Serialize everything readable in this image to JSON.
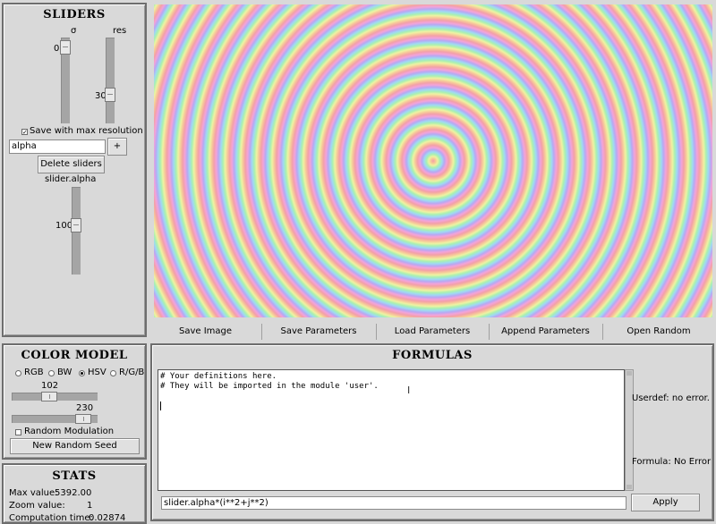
{
  "sliders_panel": {
    "title": "SLIDERS",
    "sigma_label": "σ",
    "sigma_value": "0",
    "res_label": "res",
    "res_value": "30",
    "save_max_res_label": "Save with max resolution",
    "save_max_res_checked": true,
    "new_slider_value": "alpha",
    "add_button": "+",
    "delete_button": "Delete sliders",
    "alpha_label": "slider.alpha",
    "alpha_value": "100"
  },
  "toolbar": {
    "save_image": "Save Image",
    "save_params": "Save Parameters",
    "load_params": "Load Parameters",
    "append_params": "Append Parameters",
    "open_random": "Open Random"
  },
  "color_model": {
    "title": "COLOR MODEL",
    "options": [
      "RGB",
      "BW",
      "HSV",
      "R/G/B"
    ],
    "selected": "HSV",
    "slider1_value": "102",
    "slider2_value": "230",
    "random_modulation_label": "Random Modulation",
    "random_modulation_checked": false,
    "new_seed_button": "New Random Seed"
  },
  "stats": {
    "title": "STATS",
    "max_value_label": "Max value:",
    "max_value": "5392.00",
    "zoom_label": "Zoom value:",
    "zoom_value": "1",
    "time_label": "Computation time:",
    "time_value": "0.02874"
  },
  "formulas": {
    "title": "FORMULAS",
    "code_line1": "# Your definitions here.",
    "code_line2": "# They will be imported in the module 'user'.",
    "userdef_status": "Userdef: no error.",
    "formula_status": "Formula: No Error",
    "formula_value": "slider.alpha*(i**2+j**2)",
    "apply_button": "Apply"
  }
}
